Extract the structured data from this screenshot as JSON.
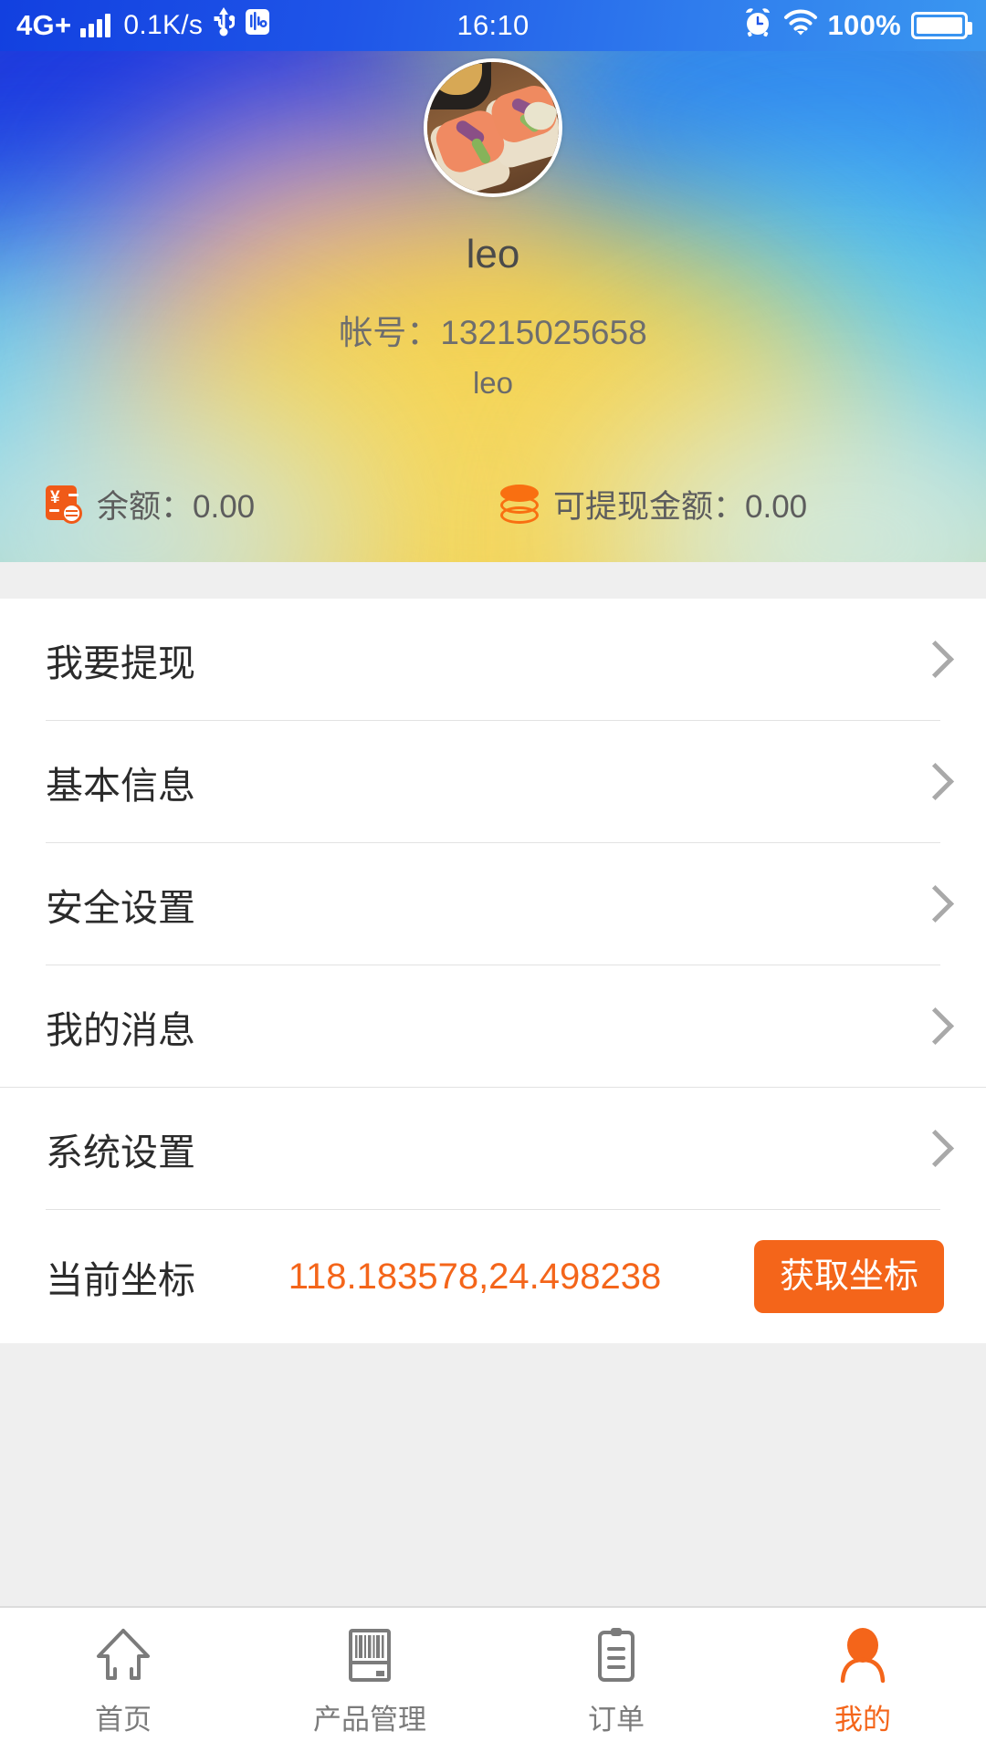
{
  "statusbar": {
    "network": "4G+",
    "speed": "0.1K/s",
    "time": "16:10",
    "battery": "100%",
    "icons": [
      "signal-bars-icon",
      "usb-icon",
      "nfc-icon",
      "alarm-clock-icon",
      "wifi-icon",
      "battery-icon"
    ]
  },
  "profile": {
    "avatar_alt": "salmon-toast-photo",
    "name": "leo",
    "account_label": "帐号：",
    "account_value": "13215025658",
    "nickname": "leo",
    "balance": {
      "icon": "wallet-exchange-icon",
      "label": "余额：",
      "value": "0.00"
    },
    "withdrawable": {
      "icon": "coins-stack-icon",
      "label": "可提现金额：",
      "value": "0.00"
    }
  },
  "menu": {
    "items": [
      {
        "label": "我要提现",
        "chevron": "chevron-right-icon"
      },
      {
        "label": "基本信息",
        "chevron": "chevron-right-icon"
      },
      {
        "label": "安全设置",
        "chevron": "chevron-right-icon"
      },
      {
        "label": "我的消息",
        "chevron": "chevron-right-icon"
      },
      {
        "label": "系统设置",
        "chevron": "chevron-right-icon"
      }
    ]
  },
  "coordinate": {
    "label": "当前坐标",
    "value": "118.183578,24.498238",
    "button": "获取坐标"
  },
  "tabbar": {
    "tabs": [
      {
        "label": "首页",
        "icon": "home-icon",
        "active": false
      },
      {
        "label": "产品管理",
        "icon": "barcode-icon",
        "active": false
      },
      {
        "label": "订单",
        "icon": "clipboard-list-icon",
        "active": false
      },
      {
        "label": "我的",
        "icon": "person-icon",
        "active": true
      }
    ]
  },
  "colors": {
    "accent_orange": "#f4651a",
    "status_blue": "#1f55e8",
    "text_primary": "#2b2b2b",
    "text_secondary": "#6e6e6e",
    "divider": "#e2e2e2"
  }
}
